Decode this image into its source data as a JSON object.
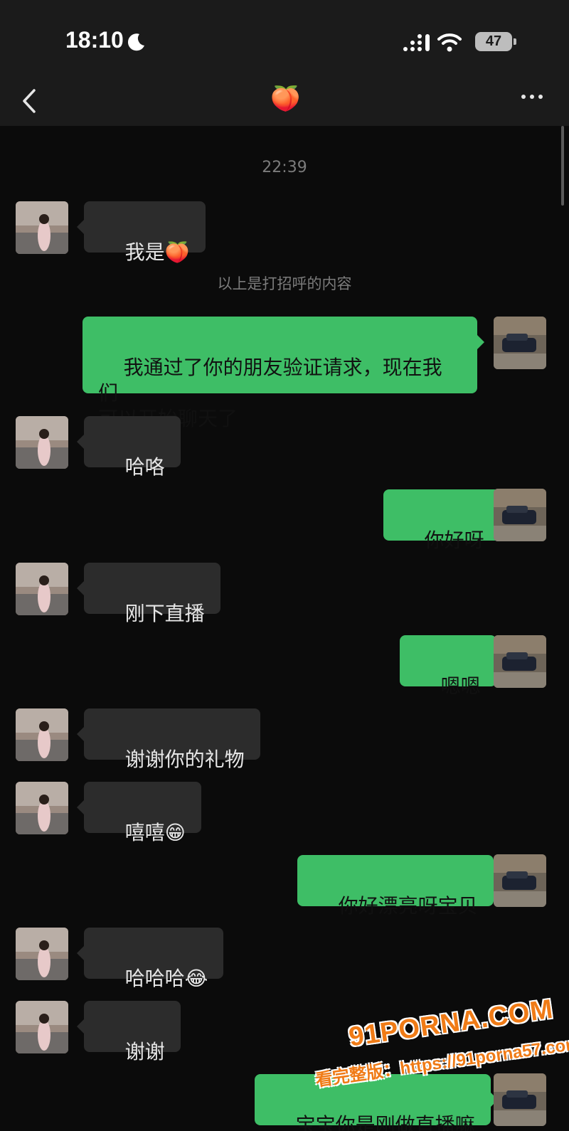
{
  "status_bar": {
    "time": "18:10",
    "battery": "47"
  },
  "header": {
    "title_emoji": "🍑"
  },
  "chat": {
    "timestamp": "22:39",
    "system_note": "以上是打招呼的内容",
    "messages": [
      {
        "side": "in",
        "text": "我是",
        "emoji": "🍑"
      },
      {
        "side": "out",
        "text": "我通过了你的朋友验证请求，现在我们\n可以开始聊天了"
      },
      {
        "side": "in",
        "text": "哈咯"
      },
      {
        "side": "out",
        "text": "你好呀"
      },
      {
        "side": "in",
        "text": "刚下直播"
      },
      {
        "side": "out",
        "text": "嗯嗯"
      },
      {
        "side": "in",
        "text": "谢谢你的礼物"
      },
      {
        "side": "in",
        "text": "嘻嘻",
        "emoji": "😁"
      },
      {
        "side": "out",
        "text": "你好漂亮呀宝贝"
      },
      {
        "side": "in",
        "text": "哈哈哈",
        "emoji": "😂"
      },
      {
        "side": "in",
        "text": "谢谢"
      },
      {
        "side": "out",
        "text": "宝宝你是刚做直播嘛"
      }
    ]
  },
  "watermark": {
    "logo": "91PORNA.COM",
    "url": "看完整版：https://91porna57.com"
  },
  "colors": {
    "outgoing_bubble": "#3ebe66",
    "incoming_bubble": "#2c2c2c",
    "background": "#0b0b0b",
    "watermark": "#f07b16"
  }
}
